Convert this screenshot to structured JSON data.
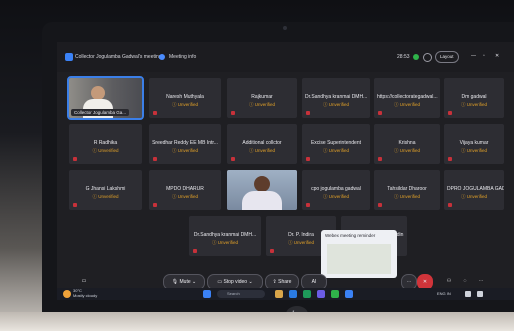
{
  "window": {
    "tab_meeting": "Collector Jogulamba Gadwal's meeting",
    "tab_info": "Meeting info",
    "timer": "28:53",
    "layout_label": "Layout"
  },
  "participants": [
    {
      "name": "Collector Jogulamba Ga...",
      "status": "",
      "video": true
    },
    {
      "name": "Naresh Muthyala",
      "status": "Unverified"
    },
    {
      "name": "Rajkumar",
      "status": "Unverified"
    },
    {
      "name": "Dr.Sandhya kranmai DMH...",
      "status": "Unverified"
    },
    {
      "name": "https://collectorategadwal...",
      "status": "Unverified"
    },
    {
      "name": "Dm gadwal",
      "status": "Unverified"
    },
    {
      "name": "R Radhika",
      "status": "Unverified"
    },
    {
      "name": "Sreedhar Reddy EE MB Intr...",
      "status": "Unverified"
    },
    {
      "name": "Additional collctor",
      "status": "Unverified"
    },
    {
      "name": "Excise Superintendent",
      "status": "Unverified"
    },
    {
      "name": "Krishna",
      "status": "Unverified"
    },
    {
      "name": "Vijaya kumar",
      "status": "Unverified"
    },
    {
      "name": "G Jhansi Lakshmi",
      "status": "Unverified"
    },
    {
      "name": "MPDO DHARUR",
      "status": "Unverified"
    },
    {
      "name": "",
      "status": "",
      "video": true
    },
    {
      "name": "cpo jogulamba gadwal",
      "status": "Unverified"
    },
    {
      "name": "Tahsildar Dharoor",
      "status": "Unverified"
    },
    {
      "name": "DPRO JOGULAMBA GADWAL",
      "status": "Unverified"
    },
    {
      "name": "Dr.Sandhya kranmai DMH...",
      "status": "Unverified"
    },
    {
      "name": "Dr. P. Indira",
      "status": "Unverified"
    },
    {
      "name": "Mohammed Raheemuddin",
      "status": "Unverified"
    }
  ],
  "toast": {
    "title": "Webex meeting reminder"
  },
  "controls": {
    "mute": "Mute",
    "stop_video": "Stop video",
    "share": "Share",
    "ai": "AI"
  },
  "taskbar": {
    "weather_temp": "30°C",
    "weather_desc": "Mostly cloudy",
    "search_placeholder": "Search",
    "lang": "ENG IN"
  }
}
